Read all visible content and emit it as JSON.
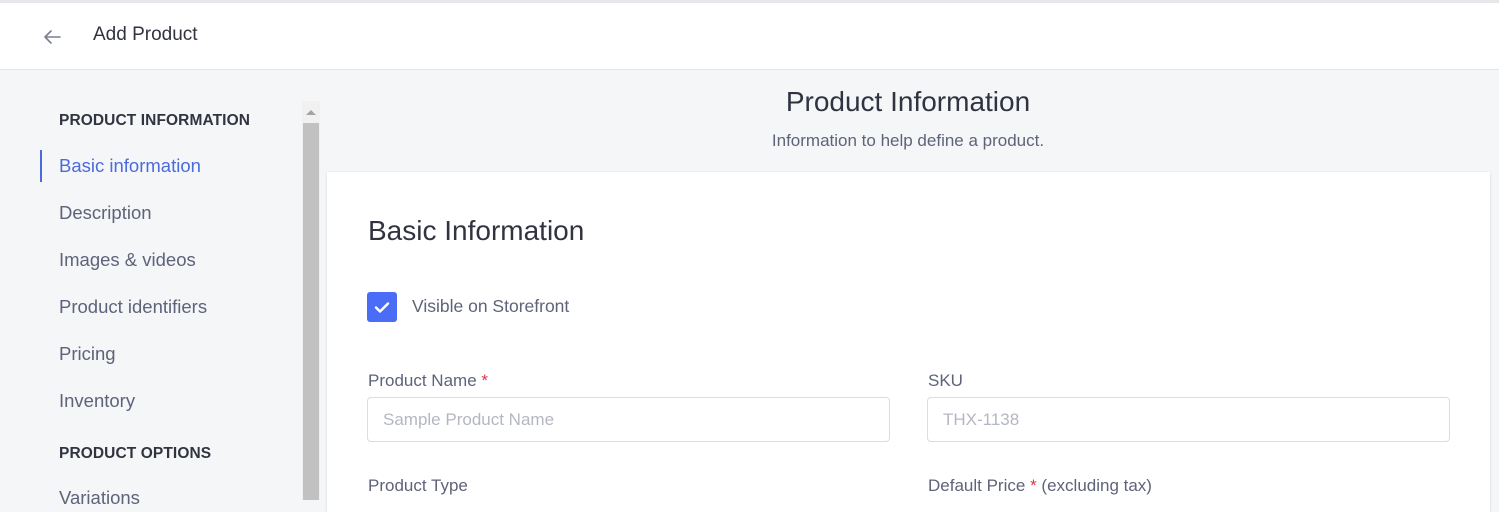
{
  "header": {
    "back_icon": "arrow-left-icon",
    "title": "Add Product"
  },
  "sidebar": {
    "sections": [
      {
        "heading": "PRODUCT INFORMATION",
        "items": [
          {
            "label": "Basic information",
            "active": true
          },
          {
            "label": "Description",
            "active": false
          },
          {
            "label": "Images & videos",
            "active": false
          },
          {
            "label": "Product identifiers",
            "active": false
          },
          {
            "label": "Pricing",
            "active": false
          },
          {
            "label": "Inventory",
            "active": false
          }
        ]
      },
      {
        "heading": "PRODUCT OPTIONS",
        "items": [
          {
            "label": "Variations",
            "active": false
          }
        ]
      }
    ]
  },
  "main": {
    "section_title": "Product Information",
    "section_subtitle": "Information to help define a product.",
    "card": {
      "title": "Basic Information",
      "visible_checkbox": {
        "label": "Visible on Storefront",
        "checked": true
      },
      "fields": {
        "product_name": {
          "label": "Product Name",
          "required_mark": "*",
          "placeholder": "Sample Product Name",
          "value": ""
        },
        "sku": {
          "label": "SKU",
          "placeholder": "THX-1138",
          "value": ""
        },
        "product_type": {
          "label": "Product Type"
        },
        "default_price": {
          "label": "Default Price",
          "required_mark": "*",
          "suffix": "(excluding tax)"
        }
      }
    }
  },
  "colors": {
    "accent": "#4a6cf7",
    "active_nav": "#4b6bdc",
    "required": "#db3643",
    "background": "#f5f6f8"
  }
}
